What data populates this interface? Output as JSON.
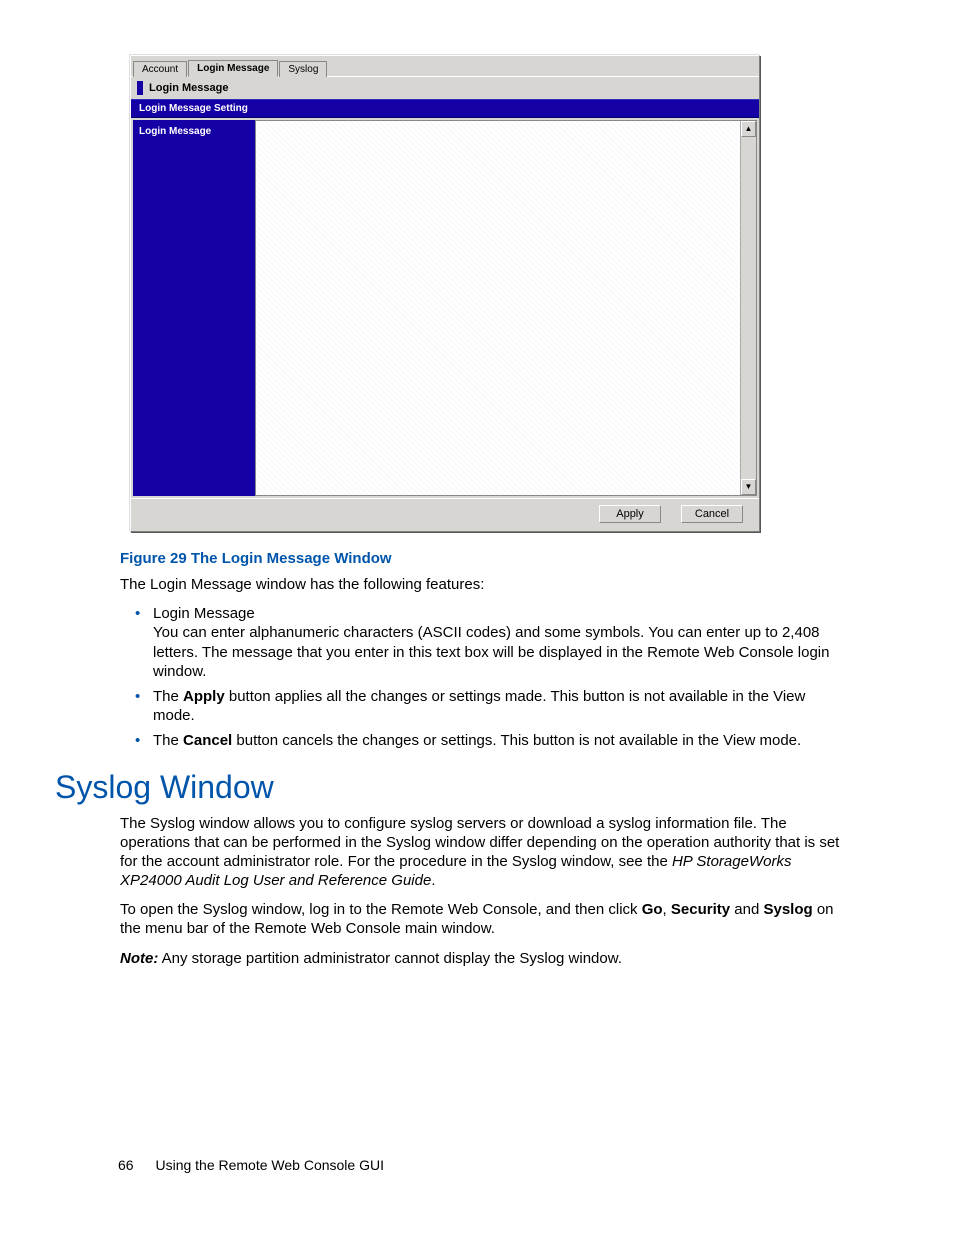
{
  "screenshot": {
    "tabs": {
      "account": "Account",
      "login_message": "Login Message",
      "syslog": "Syslog"
    },
    "panel_title": "Login Message",
    "subheader": "Login Message Setting",
    "side_label": "Login Message",
    "buttons": {
      "apply": "Apply",
      "cancel": "Cancel"
    }
  },
  "figure": {
    "caption": "Figure 29 The Login Message Window"
  },
  "intro": "The Login Message window has the following features:",
  "bullets": {
    "b1_head": "Login Message",
    "b1_body": "You can enter alphanumeric characters (ASCII codes) and some symbols. You can enter up to 2,408 letters. The message that you enter in this text box will be displayed in the Remote Web Console login window.",
    "b2_a": "The ",
    "b2_bold": "Apply",
    "b2_b": " button applies all the changes or settings made. This button is not available in the View mode.",
    "b3_a": "The ",
    "b3_bold": "Cancel",
    "b3_b": " button cancels the changes or settings. This button is not available in the View mode."
  },
  "section": {
    "heading": "Syslog Window",
    "p1a": "The Syslog window allows you to configure syslog servers or download a syslog information file. The operations that can be performed in the Syslog window differ depending on the operation authority that is set for the account administrator role. For the procedure in the Syslog window, see the ",
    "p1i": "HP StorageWorks XP24000 Audit Log User and Reference Guide",
    "p1b": ".",
    "p2a": "To open the Syslog window, log in to the Remote Web Console, and then click ",
    "p2go": "Go",
    "p2c1": ", ",
    "p2sec": "Security",
    "p2c2": " and ",
    "p2sys": "Syslog",
    "p2b": " on the menu bar of the Remote Web Console main window.",
    "p3label": "Note:",
    "p3text": " Any storage partition administrator cannot display the Syslog window."
  },
  "footer": {
    "page": "66",
    "title": "Using the Remote Web Console GUI"
  }
}
